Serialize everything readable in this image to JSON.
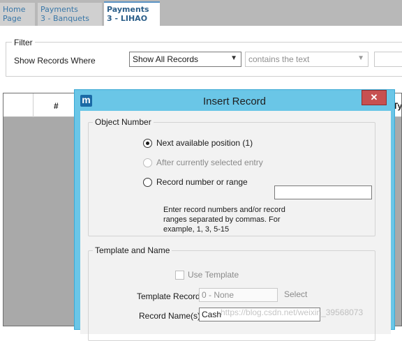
{
  "tabs": [
    {
      "label": "Home\nPage"
    },
    {
      "label": "Payments\n3 - Banquets"
    },
    {
      "label": "Payments\n3 - LIHAO"
    }
  ],
  "filter": {
    "legend": "Filter",
    "label": "Show Records Where",
    "show_value": "Show All Records",
    "condition_value": "contains the text",
    "text_value": ""
  },
  "grid": {
    "col_num": "#",
    "col_right": "e Ty"
  },
  "dialog": {
    "icon_letter": "m",
    "title": "Insert Record",
    "close_label": "✕",
    "object_group": {
      "legend": "Object Number",
      "opt_next": "Next available position (1)",
      "opt_after": "After currently selected entry",
      "opt_range": "Record number or range",
      "range_value": "",
      "hint": "Enter record numbers and/or record ranges separated by commas. For example, 1, 3, 5-15"
    },
    "template_group": {
      "legend": "Template and Name",
      "use_template": "Use Template",
      "template_label": "Template Record",
      "template_value": "0 - None",
      "select_label": "Select",
      "name_label": "Record Name(s)",
      "name_value": "Cash"
    }
  },
  "watermark": "https://blog.csdn.net/weixin_39568073"
}
